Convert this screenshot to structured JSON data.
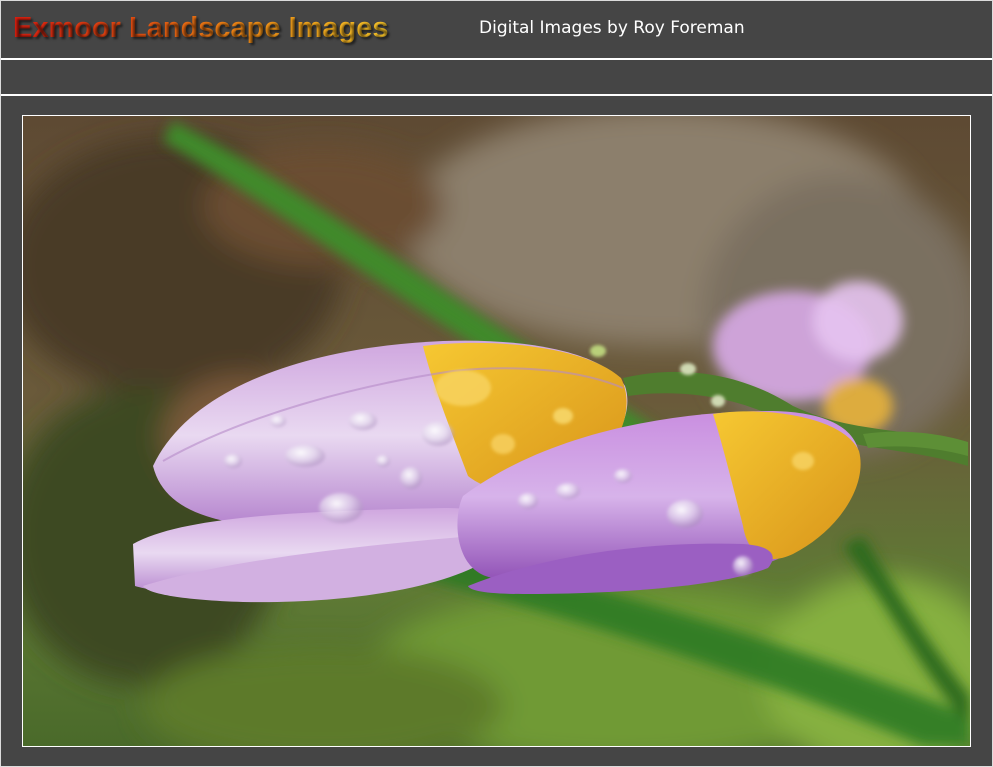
{
  "header": {
    "site_title": "Exmoor Landscape Images",
    "subtitle": "Digital Images by Roy Foreman"
  },
  "colors": {
    "page_background": "#454545",
    "title_gradient_start": "#d81e10",
    "title_gradient_end": "#f7c52b",
    "divider": "#ffffff"
  },
  "photo": {
    "subject": "crocus-buds-with-dew-drops"
  }
}
